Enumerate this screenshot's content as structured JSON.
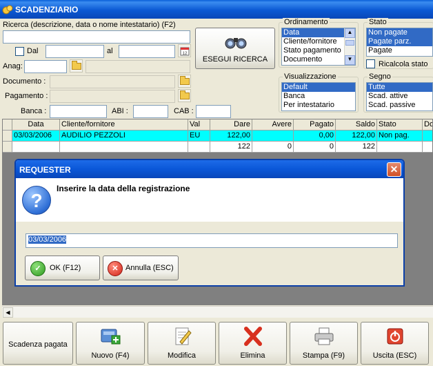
{
  "window": {
    "title": "SCADENZIARIO"
  },
  "search": {
    "label": "Ricerca (descrizione, data o nome intestatario) (F2)",
    "value": "",
    "dal_label": "Dal",
    "al_label": "al",
    "anag_label": "Anag:",
    "documento_label": "Documento :",
    "pagamento_label": "Pagamento :",
    "banca_label": "Banca :",
    "abi_label": "ABI :",
    "cab_label": "CAB :",
    "search_button": "ESEGUI RICERCA",
    "ricalcola_label": "Ricalcola stato"
  },
  "ordinamento": {
    "title": "Ordinamento",
    "options": [
      "Data",
      "Cliente/fornitore",
      "Stato pagamento",
      "Documento"
    ],
    "selected": "Data"
  },
  "stato": {
    "title": "Stato",
    "options": [
      "Non pagate",
      "Pagate parz.",
      "Pagate"
    ]
  },
  "visualizzazione": {
    "title": "Visualizzazione",
    "options": [
      "Default",
      "Banca",
      "Per intestatario"
    ]
  },
  "segno": {
    "title": "Segno",
    "options": [
      "Tutte",
      "Scad. attive",
      "Scad. passive"
    ]
  },
  "table": {
    "columns": [
      "Data",
      "Cliente/fornitore",
      "Val",
      "Dare",
      "Avere",
      "Pagato",
      "Saldo",
      "Stato",
      "Do"
    ],
    "rows": [
      [
        "03/03/2006",
        "AUDILIO PEZZOLI",
        "EU",
        "122,00",
        "",
        "0,00",
        "122,00",
        "Non pag.",
        ""
      ],
      [
        "",
        "",
        "",
        "122",
        "0",
        "0",
        "122",
        "",
        ""
      ]
    ]
  },
  "dialog": {
    "title": "REQUESTER",
    "message": "Inserire la data della registrazione",
    "input_value": "03/03/2006",
    "ok_label": "OK (F12)",
    "cancel_label": "Annulla (ESC)"
  },
  "toolbar": {
    "scadenza_label": "Scadenza pagata",
    "nuovo_label": "Nuovo (F4)",
    "modifica_label": "Modifica",
    "elimina_label": "Elimina",
    "stampa_label": "Stampa (F9)",
    "uscita_label": "Uscita (ESC)"
  },
  "colors": {
    "title_blue": "#0b59d3",
    "highlight_row": "#00ffff",
    "selection": "#316ac5"
  }
}
